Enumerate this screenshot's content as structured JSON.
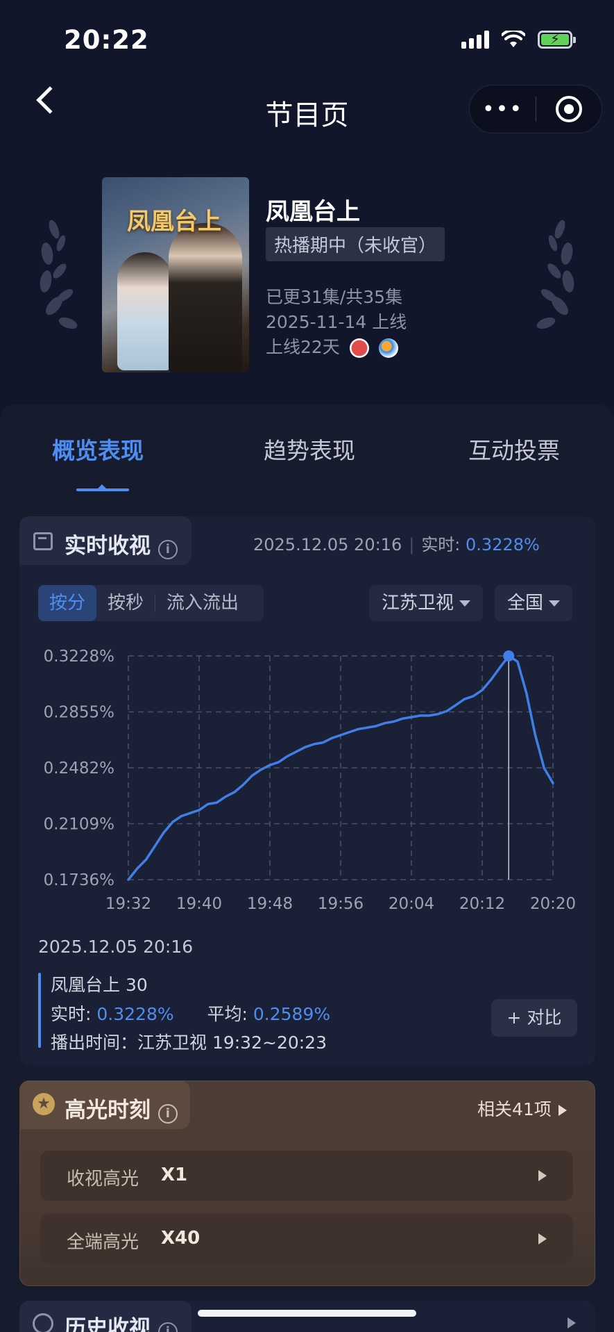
{
  "status_bar": {
    "time": "20:22"
  },
  "nav": {
    "title": "节目页"
  },
  "show": {
    "poster_title": "凤凰台上",
    "title": "凤凰台上",
    "status": "热播期中（未收官）",
    "episodes": "已更31集/共35集",
    "release": "2025-11-14 上线",
    "online_days": "上线22天"
  },
  "tabs": [
    {
      "label": "概览表现"
    },
    {
      "label": "趋势表现"
    },
    {
      "label": "互动投票"
    }
  ],
  "realtime": {
    "title": "实时收视",
    "timestamp": "2025.12.05 20:16",
    "realtime_label": "实时: ",
    "realtime_value": "0.3228%",
    "segments": [
      "按分",
      "按秒",
      "流入流出"
    ],
    "channel": "江苏卫视",
    "region": "全国"
  },
  "chart_data": {
    "type": "line",
    "x_ticks": [
      "19:32",
      "19:40",
      "19:48",
      "19:56",
      "20:04",
      "20:12",
      "20:20"
    ],
    "y_ticks": [
      "0.3228%",
      "0.2855%",
      "0.2482%",
      "0.2109%",
      "0.1736%"
    ],
    "ylim": [
      0.1736,
      0.3228
    ],
    "xlim_minutes_from_1932": [
      0,
      48
    ],
    "series": [
      {
        "name": "凤凰台上 30",
        "color": "#3f7fe6",
        "x": [
          0,
          1,
          2,
          3,
          4,
          5,
          6,
          7,
          8,
          9,
          10,
          11,
          12,
          13,
          14,
          15,
          16,
          17,
          18,
          19,
          20,
          21,
          22,
          23,
          24,
          25,
          26,
          27,
          28,
          29,
          30,
          31,
          32,
          33,
          34,
          35,
          36,
          37,
          38,
          39,
          40,
          41,
          42,
          43,
          44,
          45,
          46,
          47,
          48
        ],
        "y": [
          0.1736,
          0.181,
          0.187,
          0.196,
          0.205,
          0.212,
          0.216,
          0.218,
          0.22,
          0.224,
          0.225,
          0.229,
          0.232,
          0.237,
          0.243,
          0.247,
          0.25,
          0.252,
          0.256,
          0.259,
          0.262,
          0.264,
          0.265,
          0.268,
          0.27,
          0.272,
          0.274,
          0.275,
          0.276,
          0.278,
          0.279,
          0.281,
          0.282,
          0.283,
          0.283,
          0.284,
          0.286,
          0.29,
          0.294,
          0.296,
          0.3,
          0.307,
          0.315,
          0.3228,
          0.319,
          0.298,
          0.27,
          0.248,
          0.238
        ]
      }
    ],
    "highlight": {
      "x": 43,
      "y": 0.3228
    },
    "grid": true
  },
  "hover": {
    "time": "2025.12.05 20:16",
    "episode": "凤凰台上 30",
    "realtime_label": "实时: ",
    "realtime_value": "0.3228%",
    "avg_label": "平均: ",
    "avg_value": "0.2589%",
    "airtime": "播出时间：江苏卫视 19:32~20:23",
    "compare_label": "+ 对比"
  },
  "highlights": {
    "title": "高光时刻",
    "related": "相关41项",
    "rows": [
      {
        "label": "收视高光",
        "value": "X1"
      },
      {
        "label": "全端高光",
        "value": "X40"
      }
    ]
  },
  "history": {
    "title": "历史收视"
  },
  "colors": {
    "background": "#12162a",
    "accent": "#4f8ef0",
    "highlight_card": "#4a3a33"
  }
}
